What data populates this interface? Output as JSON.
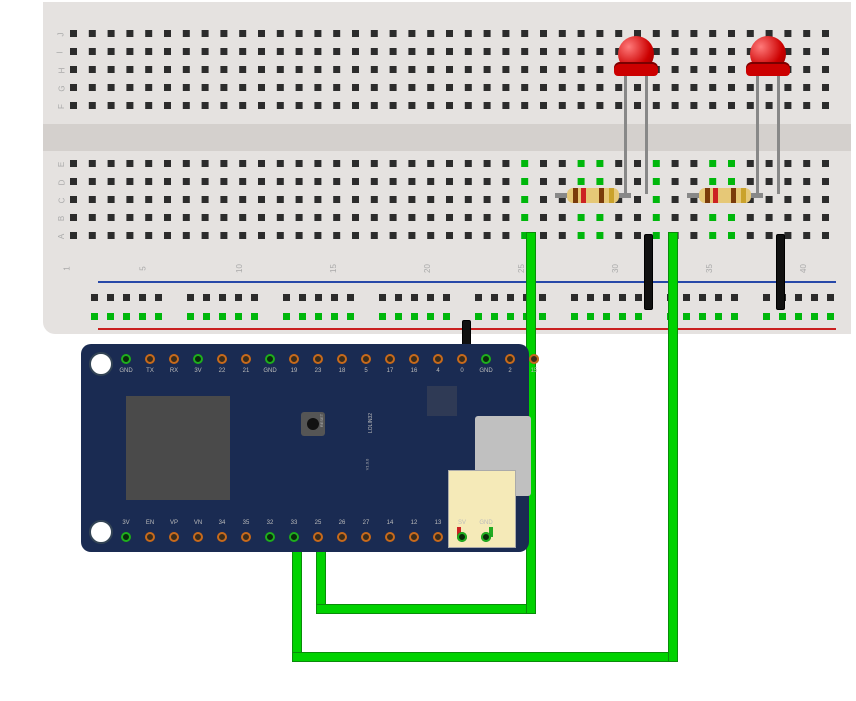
{
  "domain": "Diagram",
  "breadboard": {
    "rows_top_labels": [
      "F",
      "G",
      "H",
      "I",
      "J"
    ],
    "rows_bottom_labels": [
      "E",
      "D",
      "C",
      "B",
      "A"
    ],
    "col_labels": [
      "1",
      "5",
      "10",
      "15",
      "20",
      "25",
      "30",
      "35",
      "40"
    ]
  },
  "components": {
    "led1": {
      "type": "LED",
      "color": "red",
      "anode_col": 29,
      "cathode_col": 28
    },
    "led2": {
      "type": "LED",
      "color": "red",
      "anode_col": 36,
      "cathode_col": 35
    },
    "r1": {
      "type": "resistor",
      "from_col": 25,
      "to_col": 28,
      "row": "C"
    },
    "r2": {
      "type": "resistor",
      "from_col": 32,
      "to_col": 35,
      "row": "C"
    }
  },
  "wires": {
    "gnd_link": {
      "from": "mcu/GND",
      "to": "breadboard/bottom-rail-GND",
      "color": "black"
    },
    "gnd1": {
      "from": "breadboard/28",
      "to": "breadboard/bottom-rail-GND",
      "color": "black"
    },
    "gnd2": {
      "from": "breadboard/35",
      "to": "breadboard/bottom-rail-GND",
      "color": "black"
    },
    "sig1": {
      "from": "mcu/33",
      "to": "breadboard/col25-rowA",
      "color": "green"
    },
    "sig2": {
      "from": "mcu/32",
      "to": "breadboard/col32-rowA",
      "color": "green"
    }
  },
  "mcu": {
    "name": "LOLIN32",
    "version": "V1.0.0",
    "button": "RESET",
    "pins_top": [
      "GND",
      "TX",
      "RX",
      "3V",
      "22",
      "21",
      "GND",
      "19",
      "23",
      "18",
      "5",
      "17",
      "16",
      "4",
      "0",
      "GND",
      "2",
      "15"
    ],
    "pins_bottom": [
      "3V",
      "EN",
      "VP",
      "VN",
      "34",
      "35",
      "32",
      "33",
      "25",
      "26",
      "27",
      "14",
      "12",
      "13",
      "SV",
      "GND"
    ],
    "pins_top_on": [
      "GND",
      "3V",
      "GND",
      "GND"
    ],
    "pins_bottom_on": [
      "3V",
      "32",
      "33",
      "SV",
      "GND"
    ]
  }
}
